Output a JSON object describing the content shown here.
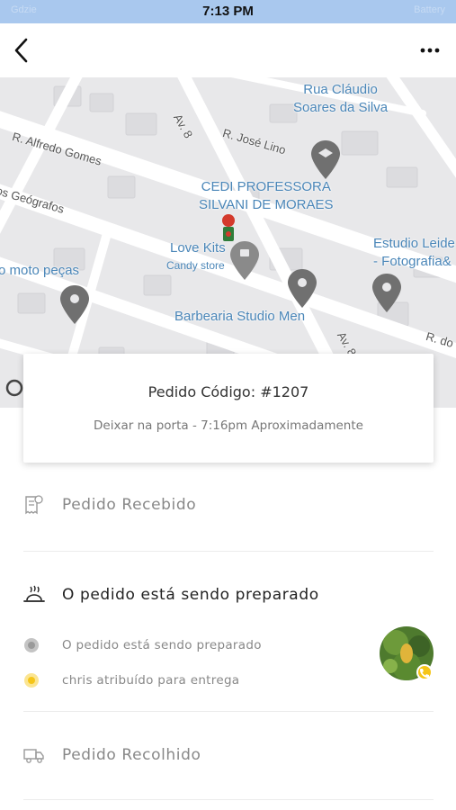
{
  "status_bar": {
    "time": "7:13 PM",
    "carrier_faint": "Gdzie",
    "right_faint": "Battery"
  },
  "header": {
    "back_icon": "chevron-left-icon",
    "more_icon": "more-horizontal-icon"
  },
  "map": {
    "streets": [
      "R. Alfredo Gomes",
      "R. José Lino",
      "Av. 8",
      "Av. 8",
      "os Geógrafos",
      "R. do"
    ],
    "places": {
      "rua_claudio_line1": "Rua Cláudio",
      "rua_claudio_line2": "Soares da Silva",
      "cedi_line1": "CEDI PROFESSORA",
      "cedi_line2": "SILVANI DE MORAES",
      "love_kits": "Love Kits",
      "candy_store": "Candy store",
      "estudio_line1": "Estudio Leide",
      "estudio_line2": "- Fotografia&",
      "moto_pecas": "o moto peças",
      "barbearia": "Barbearia Studio Men"
    }
  },
  "order": {
    "code_label": "Pedido Código: #1207",
    "eta_text": "Deixar na porta - 7:16pm Aproximadamente"
  },
  "steps": {
    "received": {
      "label": "Pedido Recebido",
      "icon": "receipt-icon"
    },
    "preparing": {
      "label": "O pedido está sendo preparado",
      "icon": "cooking-dish-icon"
    },
    "collected": {
      "label": "Pedido Recolhido",
      "icon": "delivery-truck-icon"
    }
  },
  "sub_status": [
    {
      "text": "O pedido está sendo preparado",
      "dot_color": "#c4c4c4"
    },
    {
      "text": "chris atribuído para entrega",
      "dot_color": "#f5c518"
    }
  ],
  "colors": {
    "accent": "#f5c518",
    "map_marker": "#6b6b6b",
    "map_label": "#4a86b8"
  }
}
